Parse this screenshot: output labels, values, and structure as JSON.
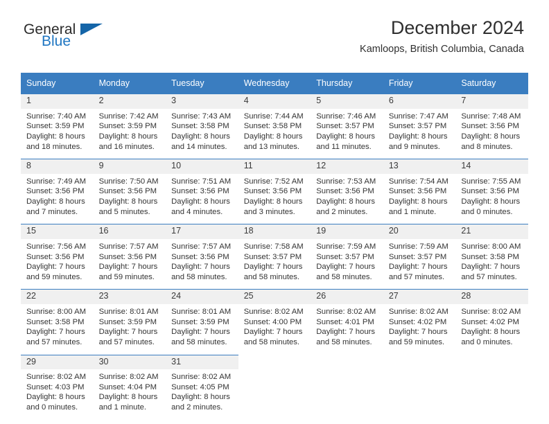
{
  "logo": {
    "word1": "General",
    "word2": "Blue",
    "mark": "triangle-icon"
  },
  "header": {
    "title": "December 2024",
    "location": "Kamloops, British Columbia, Canada"
  },
  "colors": {
    "header_blue": "#3a7dc0",
    "logo_blue": "#1f76c2",
    "daynum_band": "#f0f0f0",
    "text": "#333333"
  },
  "weekday_headers": [
    "Sunday",
    "Monday",
    "Tuesday",
    "Wednesday",
    "Thursday",
    "Friday",
    "Saturday"
  ],
  "labels": {
    "sunrise": "Sunrise:",
    "sunset": "Sunset:",
    "daylight": "Daylight:"
  },
  "weeks": [
    [
      {
        "day": "1",
        "sunrise": "Sunrise: 7:40 AM",
        "sunset": "Sunset: 3:59 PM",
        "daylight1": "Daylight: 8 hours",
        "daylight2": "and 18 minutes."
      },
      {
        "day": "2",
        "sunrise": "Sunrise: 7:42 AM",
        "sunset": "Sunset: 3:59 PM",
        "daylight1": "Daylight: 8 hours",
        "daylight2": "and 16 minutes."
      },
      {
        "day": "3",
        "sunrise": "Sunrise: 7:43 AM",
        "sunset": "Sunset: 3:58 PM",
        "daylight1": "Daylight: 8 hours",
        "daylight2": "and 14 minutes."
      },
      {
        "day": "4",
        "sunrise": "Sunrise: 7:44 AM",
        "sunset": "Sunset: 3:58 PM",
        "daylight1": "Daylight: 8 hours",
        "daylight2": "and 13 minutes."
      },
      {
        "day": "5",
        "sunrise": "Sunrise: 7:46 AM",
        "sunset": "Sunset: 3:57 PM",
        "daylight1": "Daylight: 8 hours",
        "daylight2": "and 11 minutes."
      },
      {
        "day": "6",
        "sunrise": "Sunrise: 7:47 AM",
        "sunset": "Sunset: 3:57 PM",
        "daylight1": "Daylight: 8 hours",
        "daylight2": "and 9 minutes."
      },
      {
        "day": "7",
        "sunrise": "Sunrise: 7:48 AM",
        "sunset": "Sunset: 3:56 PM",
        "daylight1": "Daylight: 8 hours",
        "daylight2": "and 8 minutes."
      }
    ],
    [
      {
        "day": "8",
        "sunrise": "Sunrise: 7:49 AM",
        "sunset": "Sunset: 3:56 PM",
        "daylight1": "Daylight: 8 hours",
        "daylight2": "and 7 minutes."
      },
      {
        "day": "9",
        "sunrise": "Sunrise: 7:50 AM",
        "sunset": "Sunset: 3:56 PM",
        "daylight1": "Daylight: 8 hours",
        "daylight2": "and 5 minutes."
      },
      {
        "day": "10",
        "sunrise": "Sunrise: 7:51 AM",
        "sunset": "Sunset: 3:56 PM",
        "daylight1": "Daylight: 8 hours",
        "daylight2": "and 4 minutes."
      },
      {
        "day": "11",
        "sunrise": "Sunrise: 7:52 AM",
        "sunset": "Sunset: 3:56 PM",
        "daylight1": "Daylight: 8 hours",
        "daylight2": "and 3 minutes."
      },
      {
        "day": "12",
        "sunrise": "Sunrise: 7:53 AM",
        "sunset": "Sunset: 3:56 PM",
        "daylight1": "Daylight: 8 hours",
        "daylight2": "and 2 minutes."
      },
      {
        "day": "13",
        "sunrise": "Sunrise: 7:54 AM",
        "sunset": "Sunset: 3:56 PM",
        "daylight1": "Daylight: 8 hours",
        "daylight2": "and 1 minute."
      },
      {
        "day": "14",
        "sunrise": "Sunrise: 7:55 AM",
        "sunset": "Sunset: 3:56 PM",
        "daylight1": "Daylight: 8 hours",
        "daylight2": "and 0 minutes."
      }
    ],
    [
      {
        "day": "15",
        "sunrise": "Sunrise: 7:56 AM",
        "sunset": "Sunset: 3:56 PM",
        "daylight1": "Daylight: 7 hours",
        "daylight2": "and 59 minutes."
      },
      {
        "day": "16",
        "sunrise": "Sunrise: 7:57 AM",
        "sunset": "Sunset: 3:56 PM",
        "daylight1": "Daylight: 7 hours",
        "daylight2": "and 59 minutes."
      },
      {
        "day": "17",
        "sunrise": "Sunrise: 7:57 AM",
        "sunset": "Sunset: 3:56 PM",
        "daylight1": "Daylight: 7 hours",
        "daylight2": "and 58 minutes."
      },
      {
        "day": "18",
        "sunrise": "Sunrise: 7:58 AM",
        "sunset": "Sunset: 3:57 PM",
        "daylight1": "Daylight: 7 hours",
        "daylight2": "and 58 minutes."
      },
      {
        "day": "19",
        "sunrise": "Sunrise: 7:59 AM",
        "sunset": "Sunset: 3:57 PM",
        "daylight1": "Daylight: 7 hours",
        "daylight2": "and 58 minutes."
      },
      {
        "day": "20",
        "sunrise": "Sunrise: 7:59 AM",
        "sunset": "Sunset: 3:57 PM",
        "daylight1": "Daylight: 7 hours",
        "daylight2": "and 57 minutes."
      },
      {
        "day": "21",
        "sunrise": "Sunrise: 8:00 AM",
        "sunset": "Sunset: 3:58 PM",
        "daylight1": "Daylight: 7 hours",
        "daylight2": "and 57 minutes."
      }
    ],
    [
      {
        "day": "22",
        "sunrise": "Sunrise: 8:00 AM",
        "sunset": "Sunset: 3:58 PM",
        "daylight1": "Daylight: 7 hours",
        "daylight2": "and 57 minutes."
      },
      {
        "day": "23",
        "sunrise": "Sunrise: 8:01 AM",
        "sunset": "Sunset: 3:59 PM",
        "daylight1": "Daylight: 7 hours",
        "daylight2": "and 57 minutes."
      },
      {
        "day": "24",
        "sunrise": "Sunrise: 8:01 AM",
        "sunset": "Sunset: 3:59 PM",
        "daylight1": "Daylight: 7 hours",
        "daylight2": "and 58 minutes."
      },
      {
        "day": "25",
        "sunrise": "Sunrise: 8:02 AM",
        "sunset": "Sunset: 4:00 PM",
        "daylight1": "Daylight: 7 hours",
        "daylight2": "and 58 minutes."
      },
      {
        "day": "26",
        "sunrise": "Sunrise: 8:02 AM",
        "sunset": "Sunset: 4:01 PM",
        "daylight1": "Daylight: 7 hours",
        "daylight2": "and 58 minutes."
      },
      {
        "day": "27",
        "sunrise": "Sunrise: 8:02 AM",
        "sunset": "Sunset: 4:02 PM",
        "daylight1": "Daylight: 7 hours",
        "daylight2": "and 59 minutes."
      },
      {
        "day": "28",
        "sunrise": "Sunrise: 8:02 AM",
        "sunset": "Sunset: 4:02 PM",
        "daylight1": "Daylight: 8 hours",
        "daylight2": "and 0 minutes."
      }
    ],
    [
      {
        "day": "29",
        "sunrise": "Sunrise: 8:02 AM",
        "sunset": "Sunset: 4:03 PM",
        "daylight1": "Daylight: 8 hours",
        "daylight2": "and 0 minutes."
      },
      {
        "day": "30",
        "sunrise": "Sunrise: 8:02 AM",
        "sunset": "Sunset: 4:04 PM",
        "daylight1": "Daylight: 8 hours",
        "daylight2": "and 1 minute."
      },
      {
        "day": "31",
        "sunrise": "Sunrise: 8:02 AM",
        "sunset": "Sunset: 4:05 PM",
        "daylight1": "Daylight: 8 hours",
        "daylight2": "and 2 minutes."
      },
      null,
      null,
      null,
      null
    ]
  ]
}
